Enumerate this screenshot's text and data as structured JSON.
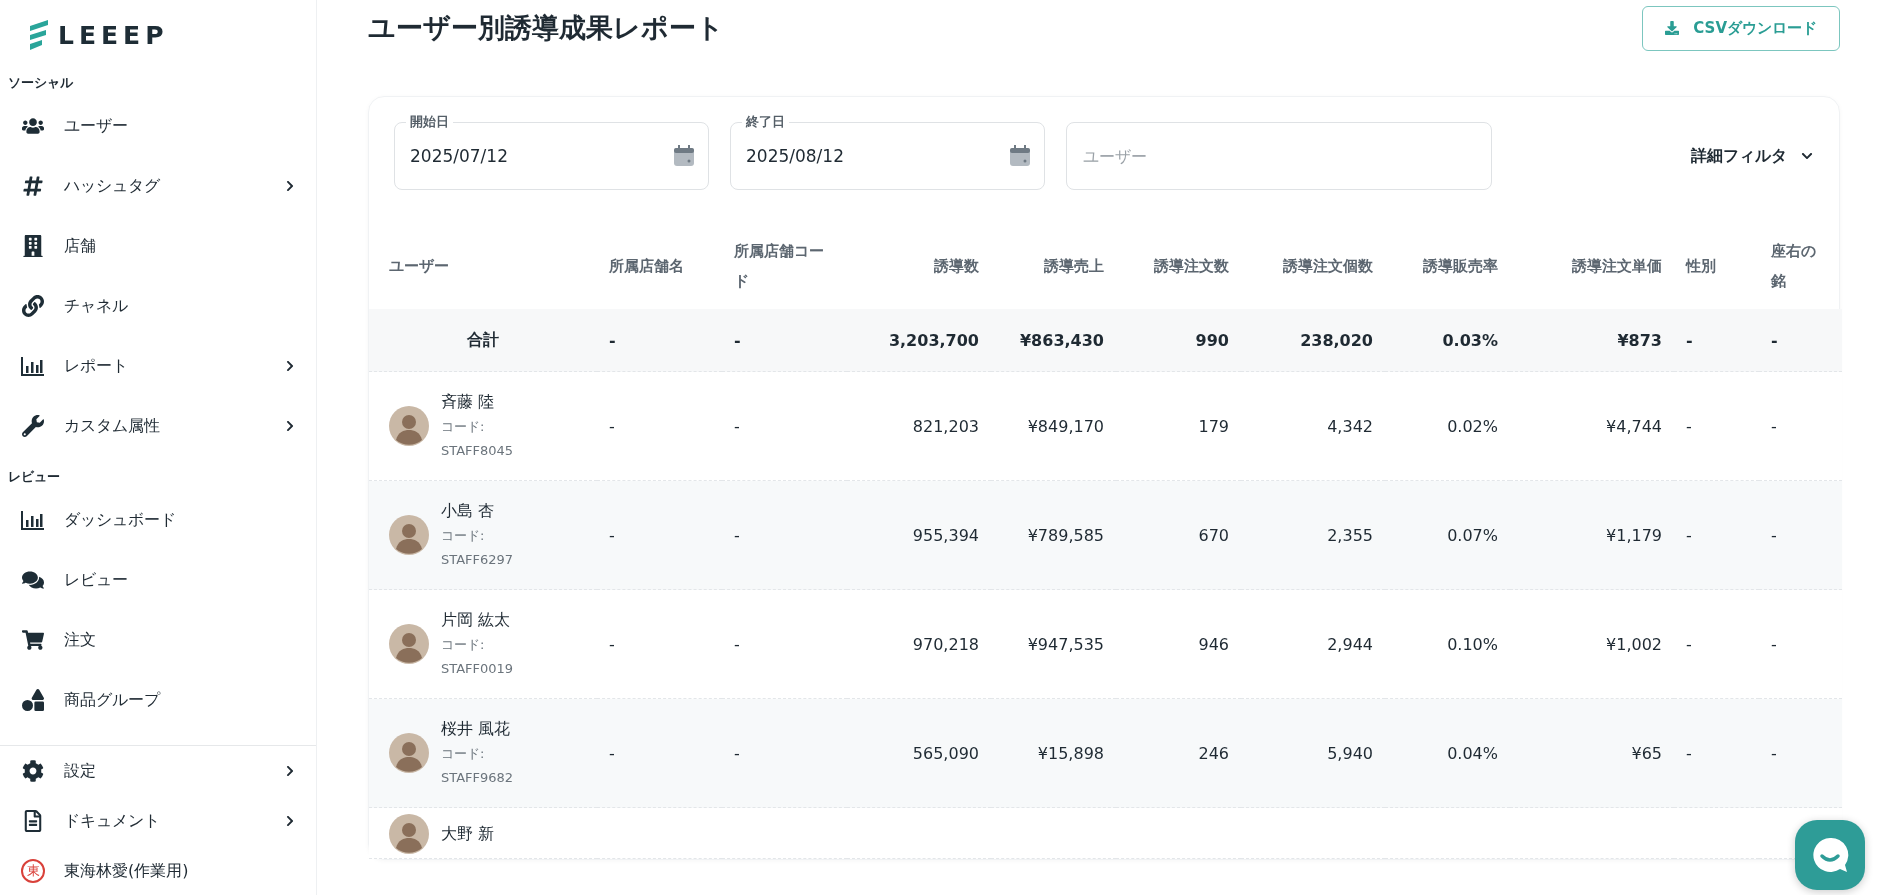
{
  "logo": {
    "text": "LEEEP"
  },
  "sidebar": {
    "sections": [
      {
        "label": "ソーシャル",
        "items": [
          {
            "label": "ユーザー",
            "expandable": false
          },
          {
            "label": "ハッシュタグ",
            "expandable": true
          },
          {
            "label": "店舗",
            "expandable": false
          },
          {
            "label": "チャネル",
            "expandable": false
          },
          {
            "label": "レポート",
            "expandable": true
          },
          {
            "label": "カスタム属性",
            "expandable": true
          }
        ]
      },
      {
        "label": "レビュー",
        "items": [
          {
            "label": "ダッシュボード",
            "expandable": false
          },
          {
            "label": "レビュー",
            "expandable": false
          },
          {
            "label": "注文",
            "expandable": false
          },
          {
            "label": "商品グループ",
            "expandable": false
          }
        ]
      }
    ],
    "bottom_items": [
      {
        "label": "設定",
        "expandable": true
      },
      {
        "label": "ドキュメント",
        "expandable": true
      }
    ],
    "account": {
      "initial": "東",
      "name": "東海林愛(作業用)"
    }
  },
  "page": {
    "title": "ユーザー別誘導成果レポート",
    "csv_button": "CSVダウンロード"
  },
  "filters": {
    "start_date": {
      "label": "開始日",
      "value": "2025/07/12"
    },
    "end_date": {
      "label": "終了日",
      "value": "2025/08/12"
    },
    "user": {
      "placeholder": "ユーザー"
    },
    "detail_filter": "詳細フィルタ"
  },
  "table": {
    "user_column": "ユーザー",
    "columns": [
      "所属店舗名",
      "所属店舗コード",
      "誘導数",
      "誘導売上",
      "誘導注文数",
      "誘導注文個数",
      "誘導販売率",
      "誘導注文単価",
      "性別",
      "座右の銘"
    ],
    "total": {
      "label": "合計",
      "cells": [
        "-",
        "-",
        "3,203,700",
        "¥863,430",
        "990",
        "238,020",
        "0.03%",
        "¥873",
        "-",
        "-"
      ]
    },
    "rows": [
      {
        "name": "斉藤 陸",
        "code": "コード: STAFF8045",
        "cells": [
          "-",
          "-",
          "821,203",
          "¥849,170",
          "179",
          "4,342",
          "0.02%",
          "¥4,744",
          "-",
          "-"
        ]
      },
      {
        "name": "小島 杏",
        "code": "コード: STAFF6297",
        "cells": [
          "-",
          "-",
          "955,394",
          "¥789,585",
          "670",
          "2,355",
          "0.07%",
          "¥1,179",
          "-",
          "-"
        ]
      },
      {
        "name": "片岡 紘太",
        "code": "コード: STAFF0019",
        "cells": [
          "-",
          "-",
          "970,218",
          "¥947,535",
          "946",
          "2,944",
          "0.10%",
          "¥1,002",
          "-",
          "-"
        ]
      },
      {
        "name": "桜井 風花",
        "code": "コード: STAFF9682",
        "cells": [
          "-",
          "-",
          "565,090",
          "¥15,898",
          "246",
          "5,940",
          "0.04%",
          "¥65",
          "-",
          "-"
        ]
      },
      {
        "name": "大野 新",
        "cells": []
      }
    ]
  }
}
